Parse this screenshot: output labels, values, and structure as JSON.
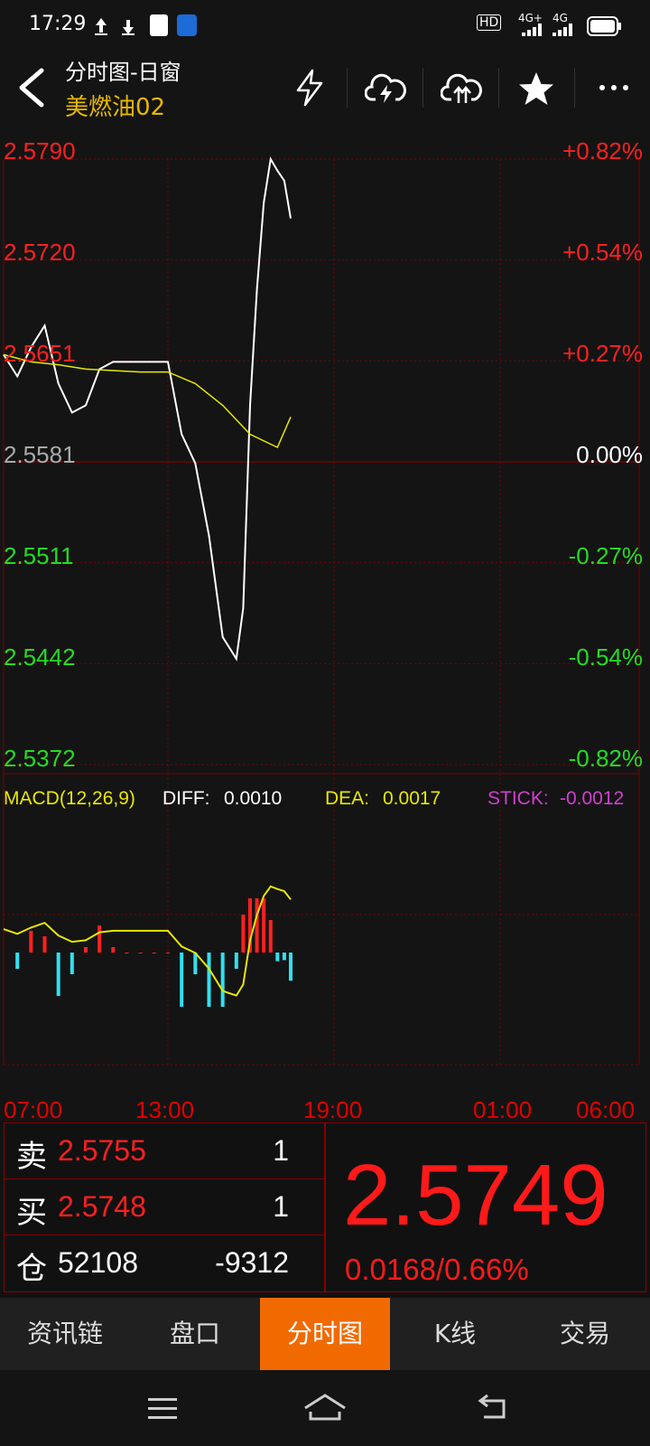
{
  "status": {
    "time": "17:29",
    "hd": "HD",
    "net1": "4G+",
    "net2": "4G"
  },
  "header": {
    "title": "分时图-日窗",
    "subtitle": "美燃油02",
    "icons": [
      "back-icon",
      "lightning-icon",
      "cloud-download-icon",
      "cloud-upload-icon",
      "star-icon",
      "more-icon"
    ]
  },
  "chart": {
    "price_labels": [
      "2.5790",
      "2.5720",
      "2.5651",
      "2.5581",
      "2.5511",
      "2.5442",
      "2.5372"
    ],
    "pct_labels": [
      "+0.82%",
      "+0.54%",
      "+0.27%",
      "0.00%",
      "-0.27%",
      "-0.54%",
      "-0.82%"
    ],
    "time_labels": [
      "07:00",
      "13:00",
      "19:00",
      "01:00",
      "06:00"
    ],
    "colors": {
      "up": "#ff2020",
      "down": "#22dd22",
      "flat": "#bbbbbb",
      "avg": "#e8e800",
      "grid": "#7a0000",
      "price_line": "#ffffff"
    }
  },
  "chart_data": {
    "type": "line",
    "title": "",
    "series": [
      {
        "name": "",
        "x": [
          "07:00",
          "07:30",
          "08:00",
          "08:30",
          "09:00",
          "09:30",
          "10:00",
          "10:30",
          "11:00",
          "11:30",
          "12:00",
          "12:30",
          "13:00",
          "13:30",
          "14:00",
          "14:30",
          "15:00",
          "15:30",
          "15:45",
          "16:00",
          "16:15",
          "16:30",
          "16:45",
          "17:00",
          "17:15",
          "17:29"
        ],
        "values": [
          2.5655,
          2.564,
          2.566,
          2.5675,
          2.5635,
          2.5615,
          2.562,
          2.5645,
          2.565,
          2.565,
          2.565,
          2.565,
          2.565,
          2.56,
          2.558,
          2.553,
          2.546,
          2.5445,
          2.548,
          2.562,
          2.57,
          2.576,
          2.579,
          2.5782,
          2.5775,
          2.5749
        ]
      },
      {
        "name": "",
        "x": [
          "07:00",
          "08:00",
          "09:00",
          "10:00",
          "11:00",
          "12:00",
          "13:00",
          "14:00",
          "15:00",
          "16:00",
          "17:00",
          "17:29"
        ],
        "values": [
          2.5655,
          2.565,
          2.5648,
          2.5645,
          2.5644,
          2.5643,
          2.5643,
          2.5635,
          2.562,
          2.56,
          2.5591,
          2.5612
        ]
      }
    ],
    "ylim": [
      2.5372,
      2.579
    ],
    "prev_close": 2.5581
  },
  "macd": {
    "title": "MACD(12,26,9)",
    "diff_label": "DIFF:",
    "diff_value": "0.0010",
    "dea_label": "DEA:",
    "dea_value": "0.0017",
    "stick_label": "STICK:",
    "stick_value": "-0.0012"
  },
  "quote": {
    "sell_label": "卖",
    "sell_price": "2.5755",
    "sell_vol": "1",
    "buy_label": "买",
    "buy_price": "2.5748",
    "buy_vol": "1",
    "oi_label": "仓",
    "oi_value": "52108",
    "oi_change": "-9312",
    "last_price": "2.5749",
    "change": "0.0168/0.66%"
  },
  "tabs": [
    {
      "label": "资讯链",
      "active": false
    },
    {
      "label": "盘口",
      "active": false
    },
    {
      "label": "分时图",
      "active": true
    },
    {
      "label": "K线",
      "active": false
    },
    {
      "label": "交易",
      "active": false
    }
  ]
}
